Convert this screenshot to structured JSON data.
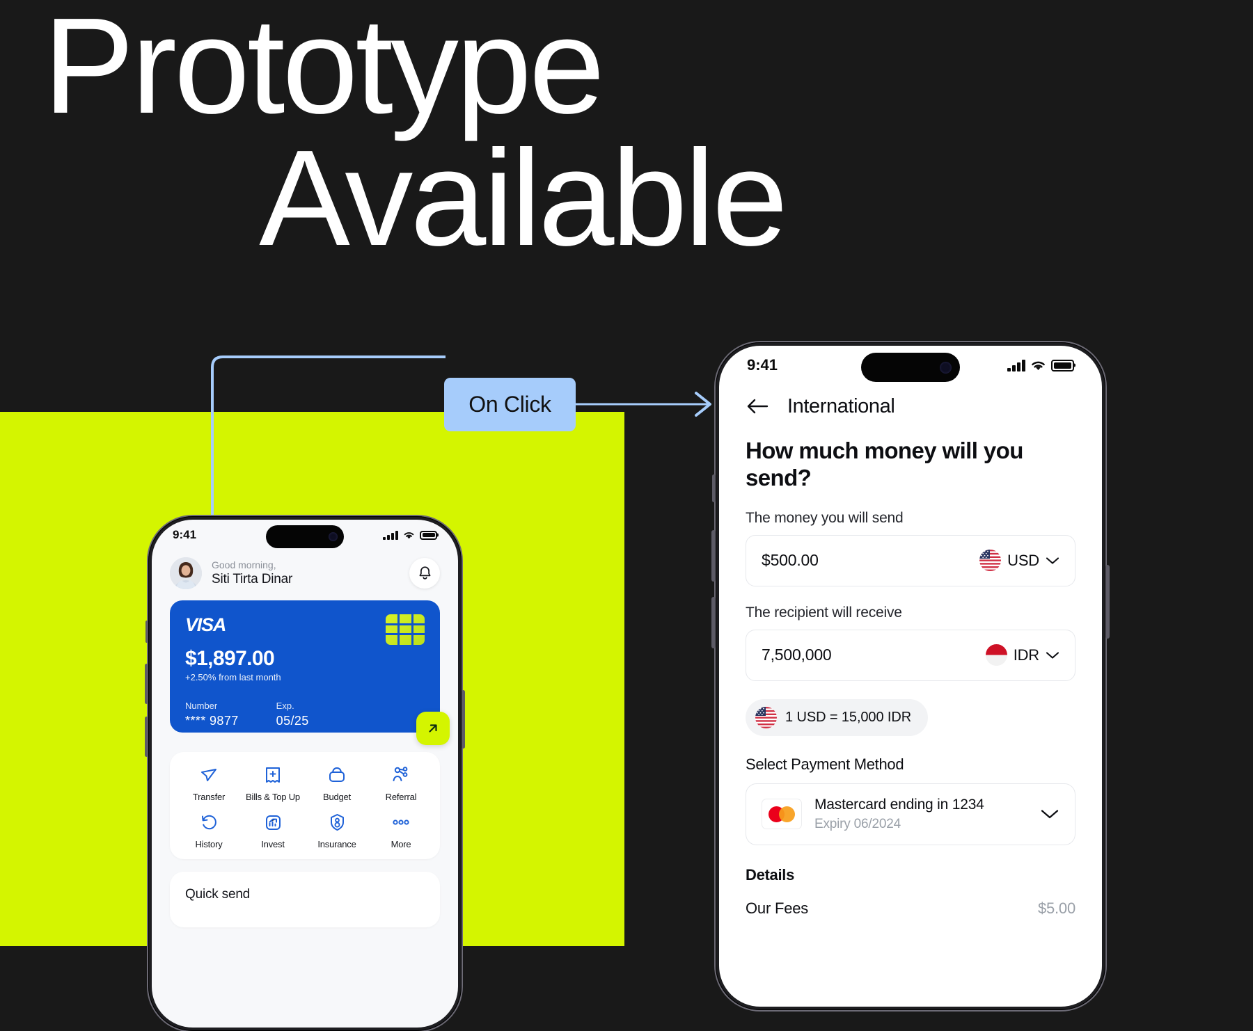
{
  "headline": {
    "line1": "Prototype",
    "line2": "Available"
  },
  "annotation": {
    "badge_label": "On Click"
  },
  "colors": {
    "background": "#191919",
    "lime_panel": "#D4F500",
    "connector_blue": "#A6CCFB",
    "visa_blue": "#1055CC",
    "accent_green": "#D4F500"
  },
  "left_phone": {
    "status_bar": {
      "time": "9:41"
    },
    "greeting": {
      "salutation": "Good morning,",
      "name": "Siti Tirta Dinar"
    },
    "notification_icon": "bell-icon",
    "card": {
      "brand": "VISA",
      "balance": "$1,897.00",
      "change": "+2.50% from last month",
      "number_label": "Number",
      "number_value": "**** 9877",
      "expiry_label": "Exp.",
      "expiry_value": "05/25",
      "fab_icon": "arrow-up-right-icon"
    },
    "actions": [
      {
        "label": "Transfer",
        "icon": "send-icon"
      },
      {
        "label": "Bills & Top Up",
        "icon": "receipt-plus-icon"
      },
      {
        "label": "Budget",
        "icon": "wallet-icon"
      },
      {
        "label": "Referral",
        "icon": "users-share-icon"
      },
      {
        "label": "History",
        "icon": "history-icon"
      },
      {
        "label": "Invest",
        "icon": "chart-up-icon"
      },
      {
        "label": "Insurance",
        "icon": "shield-user-icon"
      },
      {
        "label": "More",
        "icon": "ellipsis-icon"
      }
    ],
    "quick_send": {
      "title": "Quick send"
    }
  },
  "right_phone": {
    "status_bar": {
      "time": "9:41"
    },
    "nav": {
      "back_icon": "arrow-left-icon",
      "title": "International"
    },
    "heading": "How much money will you send?",
    "send_field": {
      "label": "The money you will send",
      "value": "$500.00",
      "currency": "USD",
      "flag": "us-flag-icon",
      "chevron": "chevron-down-icon"
    },
    "receive_field": {
      "label": "The recipient will receive",
      "value": "7,500,000",
      "currency": "IDR",
      "flag": "id-flag-icon",
      "chevron": "chevron-down-icon"
    },
    "rate_chip": {
      "flag": "us-flag-icon",
      "text": "1 USD =  15,000 IDR"
    },
    "payment": {
      "section_label": "Select Payment Method",
      "card_icon": "mastercard-icon",
      "title": "Mastercard ending in 1234",
      "subtitle": "Expiry 06/2024",
      "chevron": "chevron-down-icon"
    },
    "details": {
      "section_label": "Details",
      "rows": [
        {
          "label": "Our Fees",
          "value": "$5.00"
        }
      ]
    }
  }
}
